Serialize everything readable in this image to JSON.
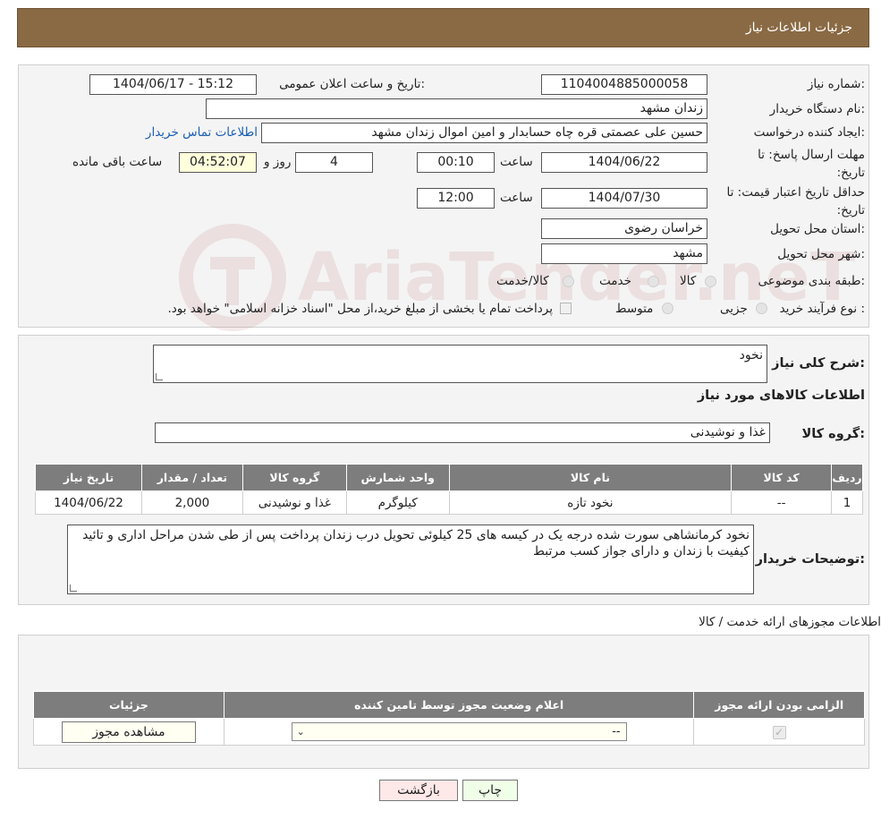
{
  "header": {
    "title": "جزئیات اطلاعات نیاز"
  },
  "watermark": {
    "text": "AriaTender.neT"
  },
  "need": {
    "number_label": "شماره نیاز:",
    "number_value": "1104004885000058",
    "announce_label": "تاریخ و ساعت اعلان عمومی:",
    "announce_value": "1404/06/17 - 15:12",
    "buyer_label": "نام دستگاه خریدار:",
    "buyer_value": "زندان مشهد",
    "creator_label": "ایجاد کننده درخواست:",
    "creator_value": "حسین علی عصمتی قره چاه حسابدار و امین اموال زندان مشهد",
    "contact_link": "اطلاعات تماس خریدار",
    "deadline_label": "مهلت ارسال پاسخ: تا تاریخ:",
    "deadline_date": "1404/06/22",
    "time_label": "ساعت",
    "deadline_time": "00:10",
    "days_value": "4",
    "days_label": "روز و",
    "remaining_value": "04:52:07",
    "remaining_label": "ساعت باقی مانده",
    "validity_label": "حداقل تاریخ اعتبار قیمت: تا تاریخ:",
    "validity_date": "1404/07/30",
    "validity_time": "12:00",
    "province_label": "استان محل تحویل:",
    "province_value": "خراسان رضوی",
    "city_label": "شهر محل تحویل:",
    "city_value": "مشهد",
    "category_label": "طبقه بندی موضوعی:",
    "category_options": [
      "کالا",
      "خدمت",
      "کالا/خدمت"
    ],
    "process_label": "نوع فرآیند خرید :",
    "process_options": [
      "جزیی",
      "متوسط"
    ],
    "process_note": "پرداخت تمام یا بخشی از مبلغ خرید،از محل \"اسناد خزانه اسلامی\" خواهد بود."
  },
  "description": {
    "label": "شرح کلی نیاز:",
    "value": "نخود",
    "goods_title": "اطلاعات کالاهای مورد نیاز",
    "group_label": "گروه کالا:",
    "group_value": "غذا و نوشیدنی"
  },
  "goods_table": {
    "headers": [
      "ردیف",
      "کد کالا",
      "نام کالا",
      "واحد شمارش",
      "گروه کالا",
      "تعداد / مقدار",
      "تاریخ نیاز"
    ],
    "rows": [
      [
        "1",
        "--",
        "نخود تازه",
        "کیلوگرم",
        "غذا و نوشیدنی",
        "2,000",
        "1404/06/22"
      ]
    ]
  },
  "buyer_notes": {
    "label": "توضیحات خریدار:",
    "value": "نخود کرمانشاهی سورت شده درجه یک در کیسه های 25 کیلوئی تحویل درب زندان پرداخت پس از طی شدن مراحل اداری و تائید کیفیت با زندان و دارای جواز کسب مرتبط"
  },
  "permits": {
    "title": "اطلاعات مجوزهای ارائه خدمت / کالا",
    "headers": [
      "الزامی بودن ارائه مجوز",
      "اعلام وضعیت مجوز توسط تامین کننده",
      "جزئیات"
    ],
    "select_value": "--",
    "view_button": "مشاهده مجوز"
  },
  "buttons": {
    "print": "چاپ",
    "back": "بازگشت"
  }
}
